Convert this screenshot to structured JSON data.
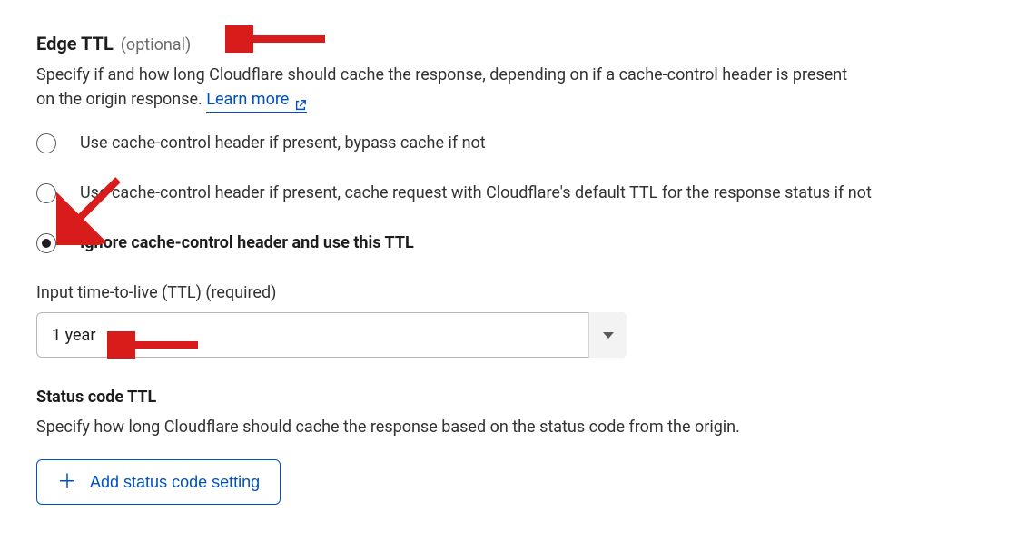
{
  "edgeTtl": {
    "title": "Edge TTL",
    "optional_tag": "(optional)",
    "description_a": "Specify if and how long Cloudflare should cache the response, depending on if a cache-control header is present on the origin response. ",
    "learn_more": "Learn more",
    "options": [
      "Use cache-control header if present, bypass cache if not",
      "Use cache-control header if present, cache request with Cloudflare's default TTL for the response status if not",
      "Ignore cache-control header and use this TTL"
    ],
    "ttl_label": "Input time-to-live (TTL) (required)",
    "ttl_value": "1 year"
  },
  "statusCodeTtl": {
    "title": "Status code TTL",
    "description": "Specify how long Cloudflare should cache the response based on the status code from the origin.",
    "add_button": "Add status code setting"
  },
  "annotation_arrow_color": "#d81b1b"
}
